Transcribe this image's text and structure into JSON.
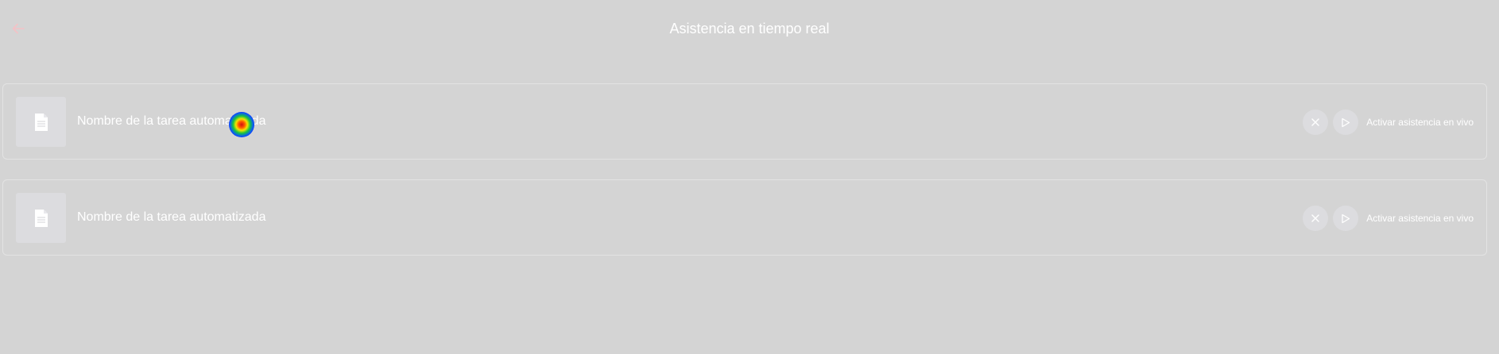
{
  "header": {
    "title": "Asistencia en tiempo real",
    "back_icon": "arrow-left-icon",
    "accent_color": "#f4c1c6"
  },
  "tasks": [
    {
      "name": "Nombre de la tarea automatizada",
      "thumbnail_icon": "document-icon",
      "cancel_icon": "close-icon",
      "play_icon": "play-icon",
      "activate_label": "Activar asistencia en vivo"
    },
    {
      "name": "Nombre de la tarea automatizada",
      "thumbnail_icon": "document-icon",
      "cancel_icon": "close-icon",
      "play_icon": "play-icon",
      "activate_label": "Activar asistencia en vivo"
    }
  ]
}
